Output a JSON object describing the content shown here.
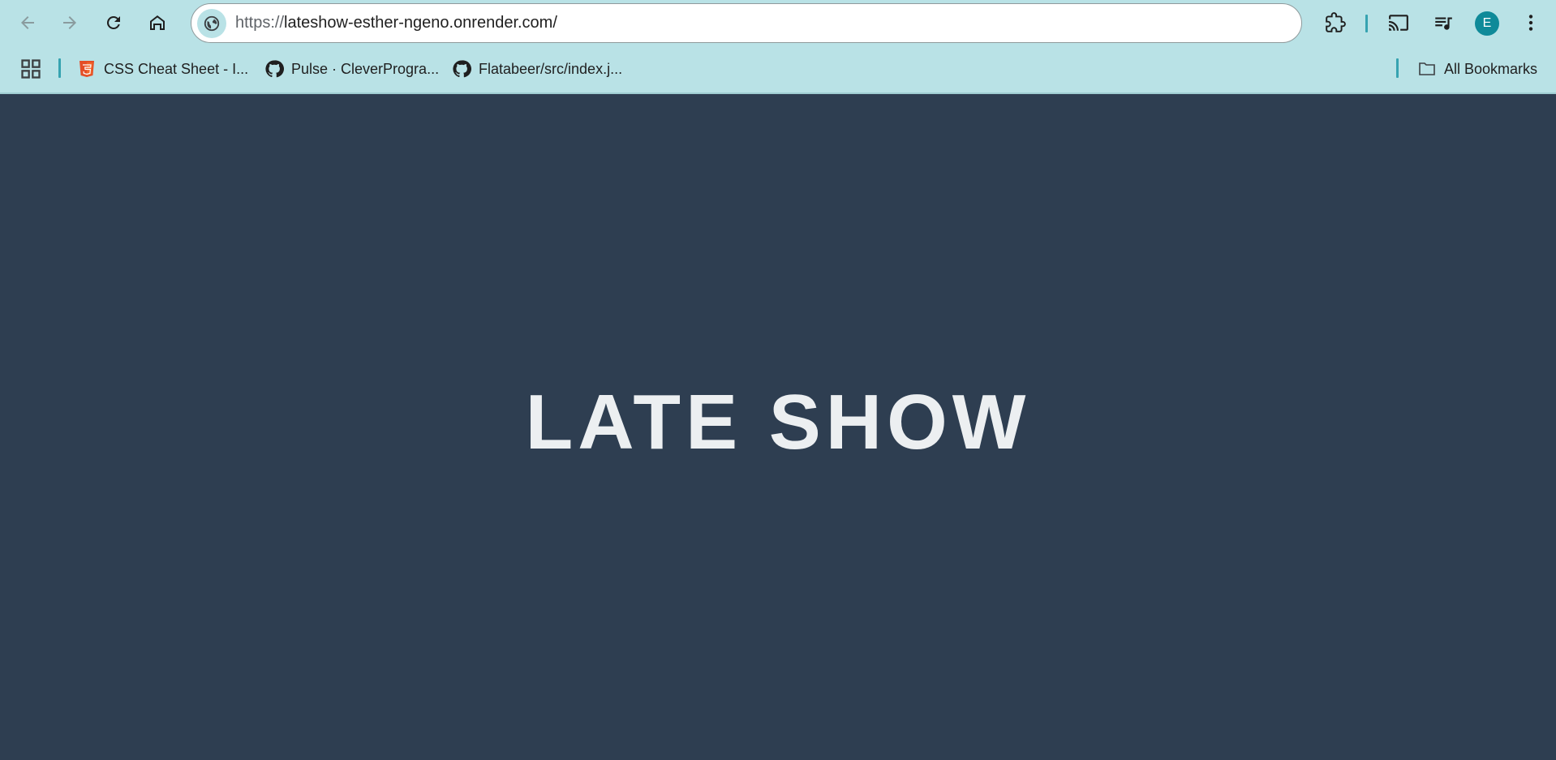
{
  "browser": {
    "url_scheme": "https://",
    "url_rest": "lateshow-esther-ngeno.onrender.com/",
    "profile_initial": "E",
    "icons": {
      "back": "arrow-left-icon",
      "forward": "arrow-right-icon",
      "reload": "reload-icon",
      "home": "home-icon",
      "site_info": "globe-icon",
      "extensions": "puzzle-icon",
      "cast": "cast-icon",
      "media": "media-playlist-icon",
      "menu": "kebab-menu-icon"
    },
    "colors": {
      "chrome_bg": "#b9e2e6",
      "accent": "#36a3b1",
      "avatar": "#0f8a99"
    }
  },
  "bookmarks": {
    "items": [
      {
        "label": "CSS Cheat Sheet - I...",
        "icon": "html5-favicon-icon"
      },
      {
        "label": "Pulse · CleverProgra...",
        "icon": "github-icon"
      },
      {
        "label": "Flatabeer/src/index.j...",
        "icon": "github-icon"
      }
    ],
    "all_label": "All Bookmarks"
  },
  "page": {
    "title": "LATE SHOW",
    "background": "#2e3e51"
  }
}
